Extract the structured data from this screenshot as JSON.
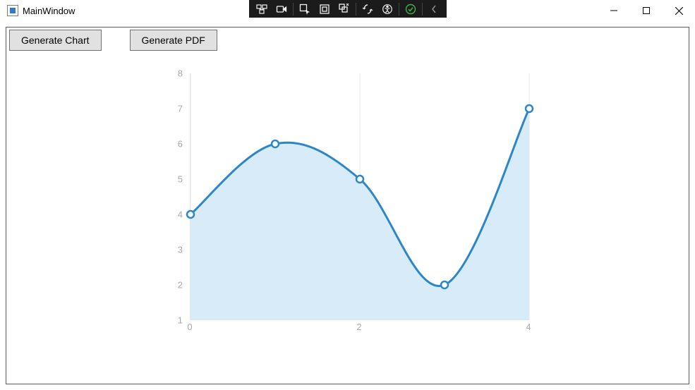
{
  "window": {
    "title": "MainWindow"
  },
  "toolbar": {
    "generate_chart_label": "Generate Chart",
    "generate_pdf_label": "Generate PDF"
  },
  "colors": {
    "series_stroke": "#2d86c8",
    "series_fill": "#d8ebf9",
    "grid": "#e8e8e8",
    "tick_label": "#a6a6a6",
    "marker_fill": "#ffffff"
  },
  "chart_data": {
    "type": "area",
    "x": [
      0,
      1,
      2,
      3,
      4
    ],
    "values": [
      4,
      6,
      5,
      2,
      7
    ],
    "xlim": [
      0,
      4
    ],
    "ylim": [
      1,
      8
    ],
    "x_ticks": [
      0,
      2,
      4
    ],
    "y_ticks": [
      1,
      2,
      3,
      4,
      5,
      6,
      7,
      8
    ],
    "grid_x": [
      0,
      2,
      4
    ],
    "title": "",
    "xlabel": "",
    "ylabel": "",
    "smooth": true,
    "markers": true
  }
}
